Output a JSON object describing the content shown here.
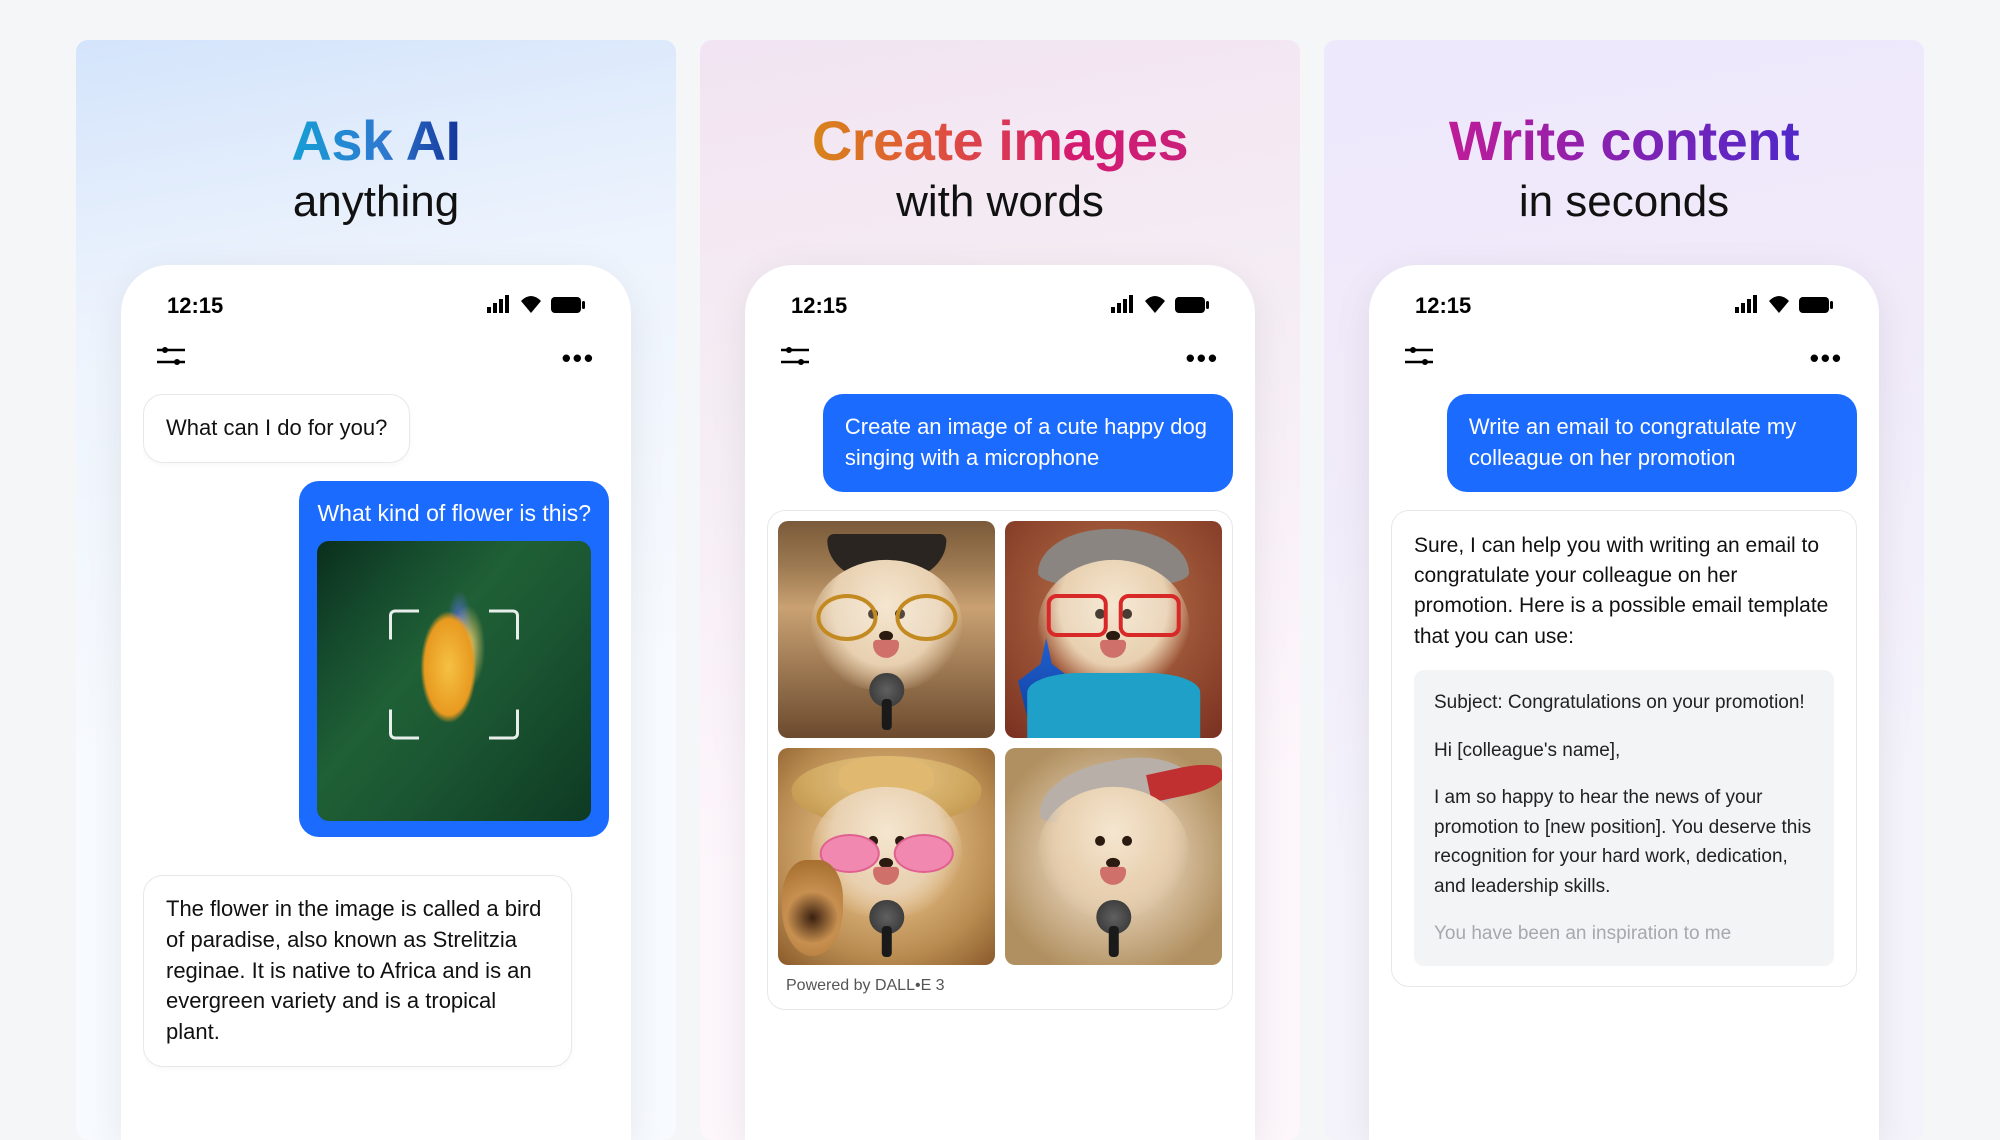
{
  "status_time": "12:15",
  "panels": {
    "ask": {
      "headline_top": "Ask AI",
      "headline_bottom": "anything",
      "ai_greeting": "What can I do for you?",
      "user_question": "What kind of flower is this?",
      "ai_answer": "The flower in the image is called a bird of paradise, also known as Strelitzia reginae. It is native to Africa and is an evergreen variety and is a tropical plant."
    },
    "create": {
      "headline_top": "Create images",
      "headline_bottom": "with words",
      "user_prompt": "Create an image of a cute happy dog singing with a microphone",
      "powered_by": "Powered by DALL•E 3"
    },
    "write": {
      "headline_top": "Write content",
      "headline_bottom": "in seconds",
      "user_prompt": "Write an email to congratulate my colleague on her promotion",
      "ai_intro": "Sure, I can help you with writing an email to congratulate your colleague on her promotion. Here is a possible email template that you can use:",
      "email_subject": "Subject: Congratulations on your promotion!",
      "email_greeting": "Hi [colleague's name],",
      "email_body": "I am so happy to hear the news of your promotion to [new position]. You deserve this recognition for your hard work, dedication, and leadership skills.",
      "email_faded": "You have been an inspiration to me"
    }
  }
}
